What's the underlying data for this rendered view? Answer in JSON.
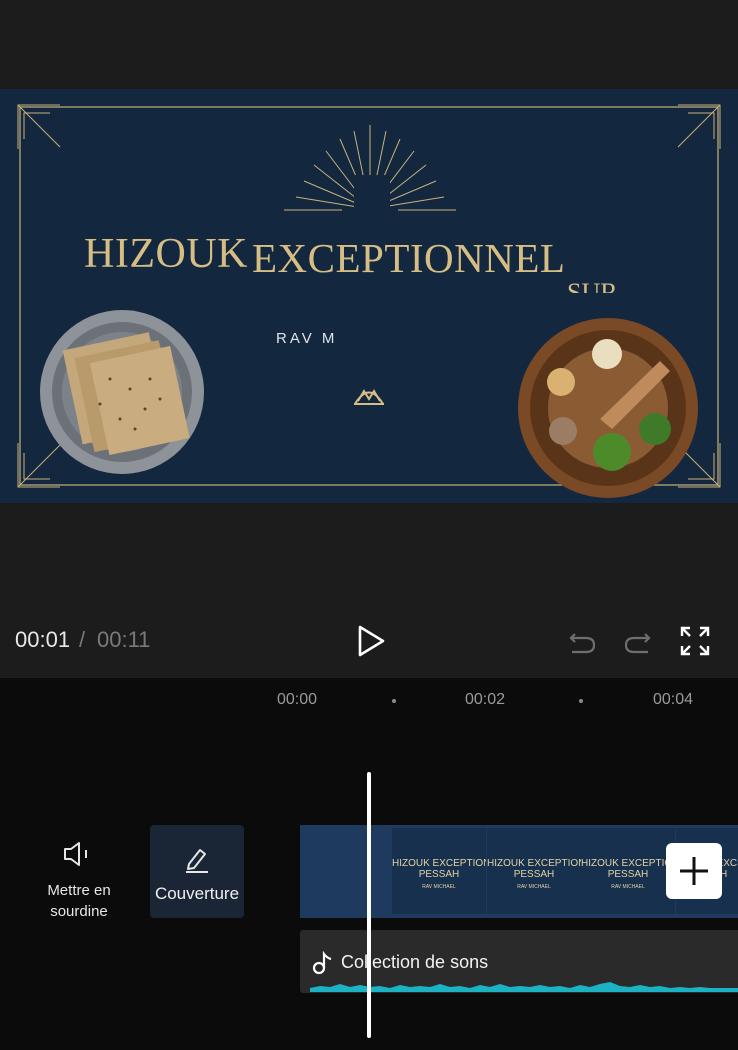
{
  "video_preview": {
    "title_left": "HIZOUK",
    "title_right": "EXCEPTIONNEL",
    "title_cut": "SUR",
    "subtitle": "RAV M"
  },
  "playback": {
    "current_time": "00:01",
    "separator": "/",
    "total_time": "00:11"
  },
  "timeline": {
    "ruler": [
      "00:00",
      "00:02",
      "00:04"
    ]
  },
  "side_tools": {
    "mute_label_line1": "Mettre en",
    "mute_label_line2": "sourdine",
    "cover_label": "Couverture"
  },
  "clip_thumbnail": {
    "line1": "HIZOUK EXCEPTIONNEL",
    "line2": "PESSAH",
    "line3": "RAV MICHAEL"
  },
  "audio_track": {
    "label": "Collection de sons"
  },
  "colors": {
    "video_bg": "#13273f",
    "gold": "#d6bd84",
    "waveform": "#1bb3c4"
  }
}
